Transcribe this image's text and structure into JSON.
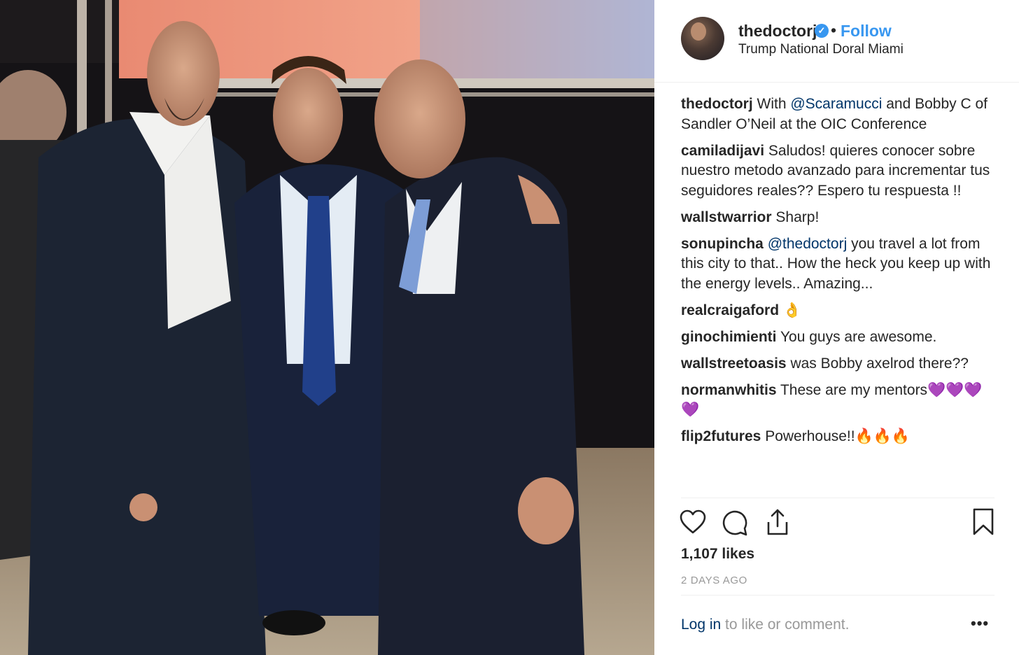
{
  "header": {
    "username": "thedoctorj",
    "dot": "•",
    "follow_label": "Follow",
    "location": "Trump National Doral Miami",
    "verified_glyph": "✓"
  },
  "caption": {
    "user": "thedoctorj",
    "text_before": "With ",
    "mention": "@Scaramucci",
    "text_after": " and Bobby C of Sandler O’Neil at the OIC Conference"
  },
  "comments": [
    {
      "user": "camiladijavi",
      "text": "Saludos! quieres conocer sobre nuestro metodo avanzado para incrementar tus seguidores reales?? Espero tu respuesta !!"
    },
    {
      "user": "wallstwarrior",
      "text": "Sharp!"
    },
    {
      "user": "sonupincha",
      "mention": "@thedoctorj",
      "text": " you travel a lot from this city to that.. How the heck you keep up with the energy levels.. Amazing..."
    },
    {
      "user": "realcraigaford",
      "text": "👌"
    },
    {
      "user": "ginochimienti",
      "text": "You guys are awesome."
    },
    {
      "user": "wallstreetoasis",
      "text": "was Bobby axelrod there??"
    },
    {
      "user": "normanwhitis",
      "text": "These are my mentors💜💜💜💜"
    },
    {
      "user": "flip2futures",
      "text": "Powerhouse!!🔥🔥🔥"
    }
  ],
  "actions": {
    "like_icon": "heart-icon",
    "comment_icon": "comment-icon",
    "share_icon": "share-icon",
    "save_icon": "bookmark-icon"
  },
  "likes": "1,107 likes",
  "time_ago": "2 DAYS AGO",
  "footer": {
    "login_link": "Log in",
    "login_rest": " to like or comment.",
    "more": "•••"
  },
  "colors": {
    "accent": "#3897f0",
    "mention": "#003569",
    "muted": "#999999",
    "text": "#262626"
  }
}
